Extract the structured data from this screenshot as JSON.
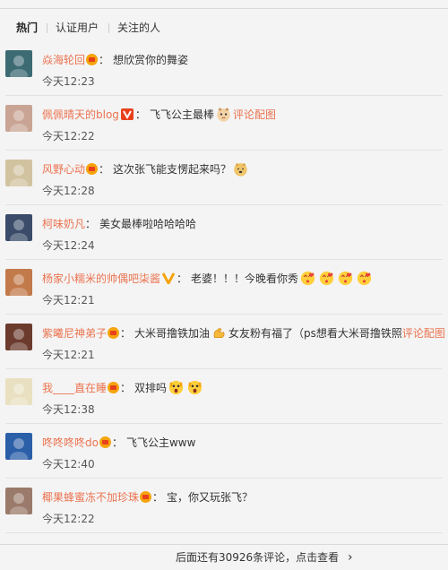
{
  "tabs": [
    {
      "label": "热门",
      "active": true
    },
    {
      "label": "认证用户",
      "active": false
    },
    {
      "label": "关注的人",
      "active": false
    }
  ],
  "comments": [
    {
      "user": "焱海轮回",
      "badge": "vip",
      "colon": "：",
      "text": "想欣赏你的舞姿",
      "emojis": [],
      "link": "",
      "time": "今天12:23",
      "avatar_color": "#3d6b74"
    },
    {
      "user": "佩佩晴天的blog",
      "badge": "v-red",
      "colon": "：",
      "text": "飞飞公主最棒",
      "emojis": [
        "cat-emoji"
      ],
      "link": "评论配图",
      "time": "今天12:22",
      "avatar_color": "#c9a494"
    },
    {
      "user": "风野心动",
      "badge": "vip",
      "colon": "：",
      "text": "这次张飞能支愣起来吗？",
      "emojis": [
        "doge-emoji"
      ],
      "link": "",
      "time": "今天12:28",
      "avatar_color": "#d2c3a0"
    },
    {
      "user": "柯味奶凡",
      "badge": "",
      "colon": "：",
      "text": "美女最棒啦哈哈哈哈",
      "emojis": [],
      "link": "",
      "time": "今天12:24",
      "avatar_color": "#3a4c6a"
    },
    {
      "user": "杨家小糯米的帅偶吧柒酱",
      "badge": "v-yellow",
      "colon": "：",
      "text": "老婆！！！今晚看你秀",
      "emojis": [
        "kiss-emoji",
        "kiss-emoji",
        "kiss-emoji",
        "kiss-emoji"
      ],
      "link": "",
      "time": "今天12:21",
      "avatar_color": "#c27a4b"
    },
    {
      "user": "紫曦尼神弟子",
      "badge": "vip",
      "colon": "：",
      "text": "大米哥撸铁加油",
      "emojis": [
        "muscle-emoji"
      ],
      "text2": "女友粉有福了（ps想看大米哥撸铁照",
      "link": "评论配图",
      "time": "今天12:21",
      "avatar_color": "#6b3b2e"
    },
    {
      "user": "我____直在睡",
      "badge": "vip",
      "colon": "：",
      "text": "双排吗",
      "emojis": [
        "shock-emoji",
        "shock-emoji"
      ],
      "link": "",
      "time": "今天12:38",
      "avatar_color": "#e8e0c0"
    },
    {
      "user": "咚咚咚咚do",
      "badge": "vip",
      "colon": "：",
      "text": "飞飞公主www",
      "emojis": [],
      "link": "",
      "time": "今天12:40",
      "avatar_color": "#2b5fa8"
    },
    {
      "user": "椰果蜂蜜冻不加珍珠",
      "badge": "vip",
      "colon": "：",
      "text": "宝，你又玩张飞？",
      "emojis": [],
      "link": "",
      "time": "今天12:22",
      "avatar_color": "#9a7a6a"
    }
  ],
  "footer": {
    "text": "后面还有30926条评论，点击查看",
    "arrow": "›"
  },
  "colors": {
    "accent": "#eb7350",
    "vip_badge": "#f6a40d",
    "background": "#f4f4f4"
  }
}
